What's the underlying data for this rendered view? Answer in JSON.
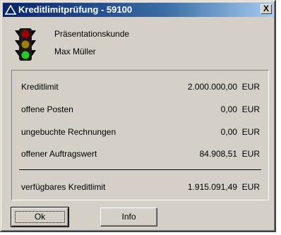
{
  "window": {
    "title": "Kreditlimitprüfung - 59100",
    "close_label": "X"
  },
  "customer": {
    "name": "Präsentationskunde",
    "contact": "Max Müller",
    "status_icon": "traffic-light"
  },
  "rows": [
    {
      "label": "Kreditlimit",
      "value": "2.000.000,00",
      "currency": "EUR"
    },
    {
      "label": "offene Posten",
      "value": "0,00",
      "currency": "EUR"
    },
    {
      "label": "ungebuchte Rechnungen",
      "value": "0,00",
      "currency": "EUR"
    },
    {
      "label": "offener Auftragswert",
      "value": "84.908,51",
      "currency": "EUR"
    }
  ],
  "total": {
    "label": "verfügbares Kreditlimit",
    "value": "1.915.091,49",
    "currency": "EUR"
  },
  "buttons": {
    "ok": "Ok",
    "info": "Info"
  },
  "colors": {
    "title_bar_start": "#0a246a",
    "title_bar_end": "#a6caf0",
    "face": "#d4d0c8"
  }
}
